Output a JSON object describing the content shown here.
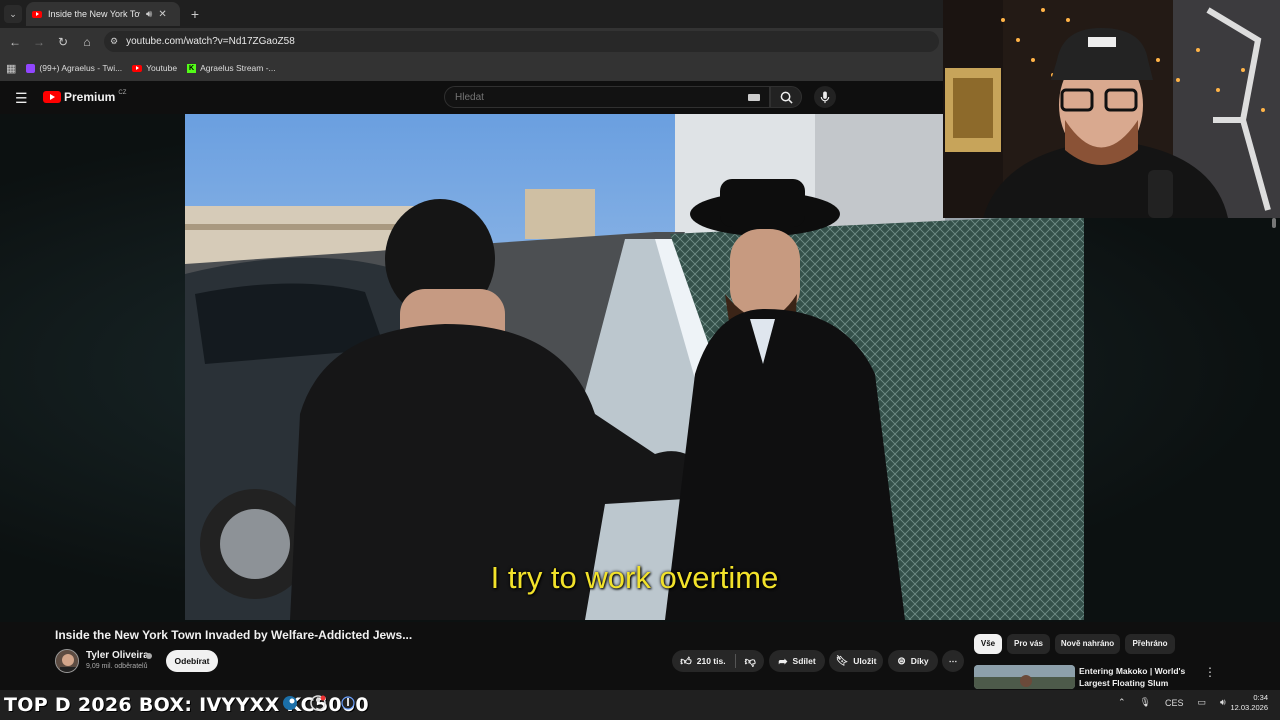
{
  "browser": {
    "tab_title": "Inside the New York Town I",
    "url": "youtube.com/watch?v=Nd17ZGaoZ58",
    "bookmarks": [
      {
        "label": "(99+) Agraelus - Twi..."
      },
      {
        "label": "Youtube"
      },
      {
        "label": "Agraelus Stream -..."
      }
    ]
  },
  "youtube": {
    "brand": "Premium",
    "region": "CZ",
    "search_placeholder": "Hledat"
  },
  "video": {
    "caption": "I try to work overtime",
    "title": "Inside the New York Town Invaded by Welfare-Addicted Jews...",
    "channel": "Tyler Oliveira",
    "subscribers": "9,09 mil. odběratelů",
    "subscribe_label": "Odebírat",
    "likes": "210 tis.",
    "share_label": "Sdílet",
    "save_label": "Uložit",
    "thanks_label": "Díky"
  },
  "sidebar": {
    "chips": [
      "Vše",
      "Pro vás",
      "Nově nahráno",
      "Přehráno"
    ],
    "recommendation_title": "Entering Makoko | World's Largest Floating Slum"
  },
  "taskbar": {
    "ticker": "TOP D 2026 BOX: IVYYXX KC5000",
    "lang": "CES",
    "time": "0:34",
    "date": "12.03.2026"
  },
  "colors": {
    "youtube_red": "#ff0000",
    "caption_yellow": "#f2e22a",
    "page_bg": "#0f0f0f"
  }
}
